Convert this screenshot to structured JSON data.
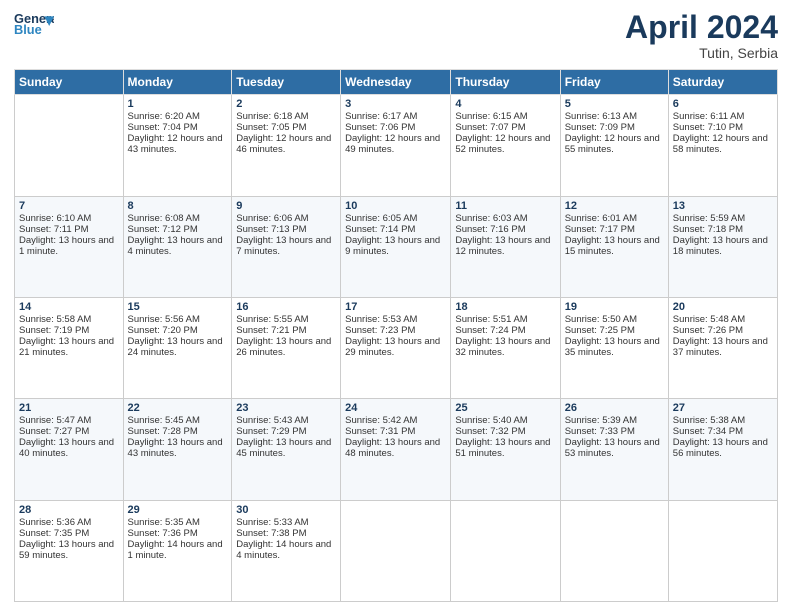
{
  "header": {
    "logo_line1": "General",
    "logo_line2": "Blue",
    "month_year": "April 2024",
    "location": "Tutin, Serbia"
  },
  "columns": [
    "Sunday",
    "Monday",
    "Tuesday",
    "Wednesday",
    "Thursday",
    "Friday",
    "Saturday"
  ],
  "weeks": [
    [
      {
        "day": "",
        "sunrise": "",
        "sunset": "",
        "daylight": ""
      },
      {
        "day": "1",
        "sunrise": "Sunrise: 6:20 AM",
        "sunset": "Sunset: 7:04 PM",
        "daylight": "Daylight: 12 hours and 43 minutes."
      },
      {
        "day": "2",
        "sunrise": "Sunrise: 6:18 AM",
        "sunset": "Sunset: 7:05 PM",
        "daylight": "Daylight: 12 hours and 46 minutes."
      },
      {
        "day": "3",
        "sunrise": "Sunrise: 6:17 AM",
        "sunset": "Sunset: 7:06 PM",
        "daylight": "Daylight: 12 hours and 49 minutes."
      },
      {
        "day": "4",
        "sunrise": "Sunrise: 6:15 AM",
        "sunset": "Sunset: 7:07 PM",
        "daylight": "Daylight: 12 hours and 52 minutes."
      },
      {
        "day": "5",
        "sunrise": "Sunrise: 6:13 AM",
        "sunset": "Sunset: 7:09 PM",
        "daylight": "Daylight: 12 hours and 55 minutes."
      },
      {
        "day": "6",
        "sunrise": "Sunrise: 6:11 AM",
        "sunset": "Sunset: 7:10 PM",
        "daylight": "Daylight: 12 hours and 58 minutes."
      }
    ],
    [
      {
        "day": "7",
        "sunrise": "Sunrise: 6:10 AM",
        "sunset": "Sunset: 7:11 PM",
        "daylight": "Daylight: 13 hours and 1 minute."
      },
      {
        "day": "8",
        "sunrise": "Sunrise: 6:08 AM",
        "sunset": "Sunset: 7:12 PM",
        "daylight": "Daylight: 13 hours and 4 minutes."
      },
      {
        "day": "9",
        "sunrise": "Sunrise: 6:06 AM",
        "sunset": "Sunset: 7:13 PM",
        "daylight": "Daylight: 13 hours and 7 minutes."
      },
      {
        "day": "10",
        "sunrise": "Sunrise: 6:05 AM",
        "sunset": "Sunset: 7:14 PM",
        "daylight": "Daylight: 13 hours and 9 minutes."
      },
      {
        "day": "11",
        "sunrise": "Sunrise: 6:03 AM",
        "sunset": "Sunset: 7:16 PM",
        "daylight": "Daylight: 13 hours and 12 minutes."
      },
      {
        "day": "12",
        "sunrise": "Sunrise: 6:01 AM",
        "sunset": "Sunset: 7:17 PM",
        "daylight": "Daylight: 13 hours and 15 minutes."
      },
      {
        "day": "13",
        "sunrise": "Sunrise: 5:59 AM",
        "sunset": "Sunset: 7:18 PM",
        "daylight": "Daylight: 13 hours and 18 minutes."
      }
    ],
    [
      {
        "day": "14",
        "sunrise": "Sunrise: 5:58 AM",
        "sunset": "Sunset: 7:19 PM",
        "daylight": "Daylight: 13 hours and 21 minutes."
      },
      {
        "day": "15",
        "sunrise": "Sunrise: 5:56 AM",
        "sunset": "Sunset: 7:20 PM",
        "daylight": "Daylight: 13 hours and 24 minutes."
      },
      {
        "day": "16",
        "sunrise": "Sunrise: 5:55 AM",
        "sunset": "Sunset: 7:21 PM",
        "daylight": "Daylight: 13 hours and 26 minutes."
      },
      {
        "day": "17",
        "sunrise": "Sunrise: 5:53 AM",
        "sunset": "Sunset: 7:23 PM",
        "daylight": "Daylight: 13 hours and 29 minutes."
      },
      {
        "day": "18",
        "sunrise": "Sunrise: 5:51 AM",
        "sunset": "Sunset: 7:24 PM",
        "daylight": "Daylight: 13 hours and 32 minutes."
      },
      {
        "day": "19",
        "sunrise": "Sunrise: 5:50 AM",
        "sunset": "Sunset: 7:25 PM",
        "daylight": "Daylight: 13 hours and 35 minutes."
      },
      {
        "day": "20",
        "sunrise": "Sunrise: 5:48 AM",
        "sunset": "Sunset: 7:26 PM",
        "daylight": "Daylight: 13 hours and 37 minutes."
      }
    ],
    [
      {
        "day": "21",
        "sunrise": "Sunrise: 5:47 AM",
        "sunset": "Sunset: 7:27 PM",
        "daylight": "Daylight: 13 hours and 40 minutes."
      },
      {
        "day": "22",
        "sunrise": "Sunrise: 5:45 AM",
        "sunset": "Sunset: 7:28 PM",
        "daylight": "Daylight: 13 hours and 43 minutes."
      },
      {
        "day": "23",
        "sunrise": "Sunrise: 5:43 AM",
        "sunset": "Sunset: 7:29 PM",
        "daylight": "Daylight: 13 hours and 45 minutes."
      },
      {
        "day": "24",
        "sunrise": "Sunrise: 5:42 AM",
        "sunset": "Sunset: 7:31 PM",
        "daylight": "Daylight: 13 hours and 48 minutes."
      },
      {
        "day": "25",
        "sunrise": "Sunrise: 5:40 AM",
        "sunset": "Sunset: 7:32 PM",
        "daylight": "Daylight: 13 hours and 51 minutes."
      },
      {
        "day": "26",
        "sunrise": "Sunrise: 5:39 AM",
        "sunset": "Sunset: 7:33 PM",
        "daylight": "Daylight: 13 hours and 53 minutes."
      },
      {
        "day": "27",
        "sunrise": "Sunrise: 5:38 AM",
        "sunset": "Sunset: 7:34 PM",
        "daylight": "Daylight: 13 hours and 56 minutes."
      }
    ],
    [
      {
        "day": "28",
        "sunrise": "Sunrise: 5:36 AM",
        "sunset": "Sunset: 7:35 PM",
        "daylight": "Daylight: 13 hours and 59 minutes."
      },
      {
        "day": "29",
        "sunrise": "Sunrise: 5:35 AM",
        "sunset": "Sunset: 7:36 PM",
        "daylight": "Daylight: 14 hours and 1 minute."
      },
      {
        "day": "30",
        "sunrise": "Sunrise: 5:33 AM",
        "sunset": "Sunset: 7:38 PM",
        "daylight": "Daylight: 14 hours and 4 minutes."
      },
      {
        "day": "",
        "sunrise": "",
        "sunset": "",
        "daylight": ""
      },
      {
        "day": "",
        "sunrise": "",
        "sunset": "",
        "daylight": ""
      },
      {
        "day": "",
        "sunrise": "",
        "sunset": "",
        "daylight": ""
      },
      {
        "day": "",
        "sunrise": "",
        "sunset": "",
        "daylight": ""
      }
    ]
  ]
}
